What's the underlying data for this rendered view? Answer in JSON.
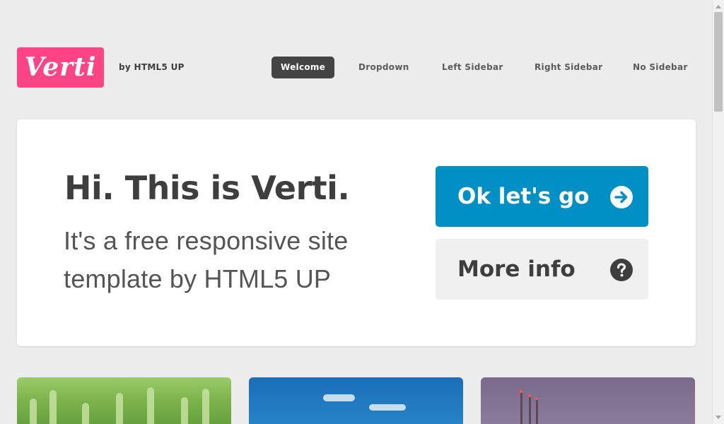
{
  "header": {
    "logo_text": "Verti",
    "byline": "by HTML5 UP",
    "brand_color": "#ff4486"
  },
  "nav": {
    "items": [
      {
        "label": "Welcome",
        "active": true
      },
      {
        "label": "Dropdown",
        "active": false
      },
      {
        "label": "Left Sidebar",
        "active": false
      },
      {
        "label": "Right Sidebar",
        "active": false
      },
      {
        "label": "No Sidebar",
        "active": false
      }
    ]
  },
  "banner": {
    "title": "Hi. This is Verti.",
    "subtitle_line1": "It's a free responsive site",
    "subtitle_line2": "template by HTML5 UP",
    "primary_button": {
      "label": "Ok let's go",
      "icon": "arrow-right-circle-icon",
      "color": "#0090c5"
    },
    "secondary_button": {
      "label": "More info",
      "icon": "question-circle-icon",
      "color": "#f0f0f0"
    }
  },
  "features": {
    "images": [
      "wheat-field-image",
      "blue-sky-image",
      "power-towers-image"
    ]
  }
}
